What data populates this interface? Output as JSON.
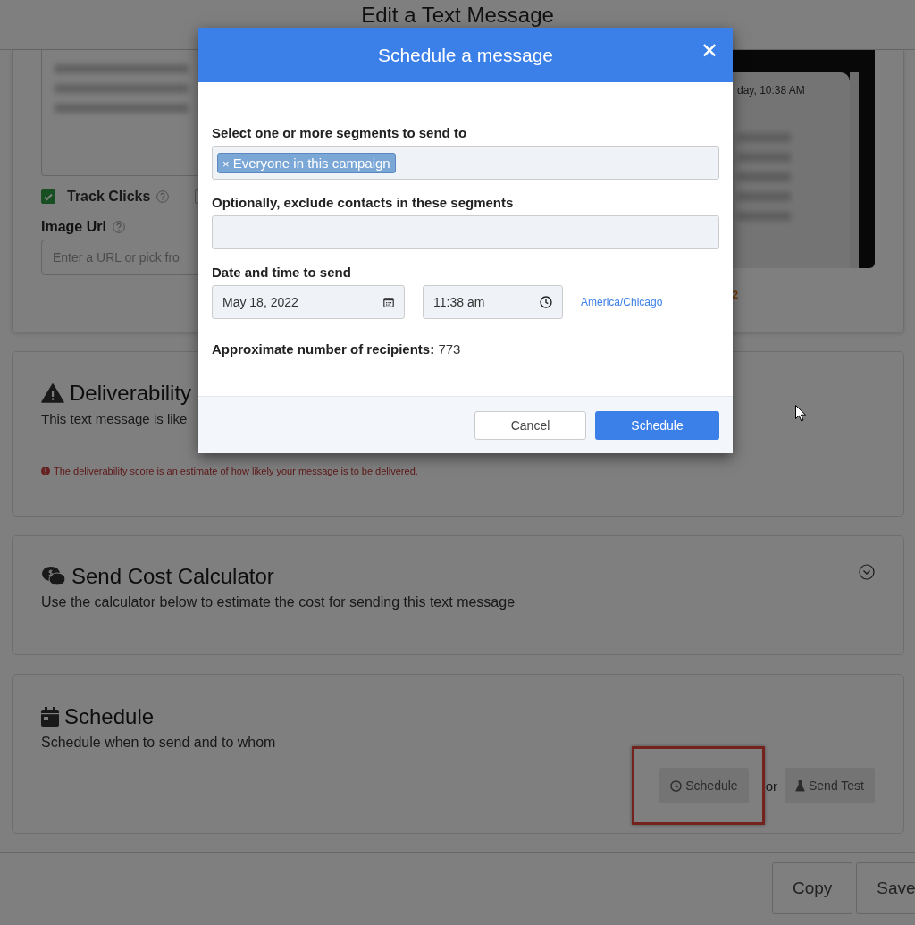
{
  "page": {
    "title": "Edit a Text Message"
  },
  "message_card": {
    "track_clicks": {
      "label": "Track Clicks",
      "checked": true
    },
    "second_checkbox": {
      "checked": false
    },
    "image_url": {
      "label": "Image Url",
      "placeholder": "Enter a URL or pick fro"
    },
    "preview": {
      "timestamp": "day, 10:38 AM",
      "counter": "2"
    }
  },
  "deliverability": {
    "title": "Deliverability",
    "text": "This text message is like",
    "note": "The deliverability score is an estimate of how likely your message is to be delivered."
  },
  "cost_calculator": {
    "title": "Send Cost Calculator",
    "text": "Use the calculator below to estimate the cost for sending this text message",
    "expanded": false
  },
  "schedule_section": {
    "title": "Schedule",
    "text": "Schedule when to send and to whom",
    "schedule_button": "Schedule",
    "or": "or",
    "send_test_button": "Send Test",
    "highlighted": true
  },
  "footer": {
    "buttons": [
      "Copy",
      "Save"
    ]
  },
  "dialog": {
    "title": "Schedule a message",
    "close": "✕",
    "segments_label": "Select one or more segments to send to",
    "segments": [
      {
        "label": "Everyone in this campaign",
        "remove": "×"
      }
    ],
    "exclude_label": "Optionally, exclude contacts in these segments",
    "datetime_label": "Date and time to send",
    "date": "May 18, 2022",
    "time": "11:38 am",
    "timezone": "America/Chicago",
    "recipients_label": "Approximate number of recipients:",
    "recipients": "773",
    "cancel": "Cancel",
    "submit": "Schedule"
  }
}
